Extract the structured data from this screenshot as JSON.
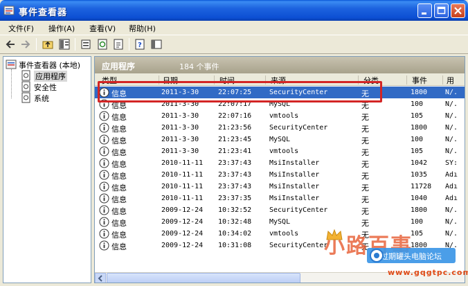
{
  "window": {
    "title": "事件查看器"
  },
  "menu": {
    "file": "文件(F)",
    "action": "操作(A)",
    "view": "查看(V)",
    "help": "帮助(H)"
  },
  "tree": {
    "root": "事件查看器 (本地)",
    "items": [
      "应用程序",
      "安全性",
      "系统"
    ]
  },
  "pane": {
    "title": "应用程序",
    "count": "184 个事件"
  },
  "columns": [
    "类型",
    "日期",
    "时间",
    "来源",
    "分类",
    "事件",
    "用"
  ],
  "rows": [
    {
      "type": "信息",
      "date": "2011-3-30",
      "time": "22:07:25",
      "source": "SecurityCenter",
      "category": "无",
      "event": "1800",
      "user": "N/."
    },
    {
      "type": "信息",
      "date": "2011-3-30",
      "time": "22:07:17",
      "source": "MySQL",
      "category": "无",
      "event": "100",
      "user": "N/."
    },
    {
      "type": "信息",
      "date": "2011-3-30",
      "time": "22:07:16",
      "source": "vmtools",
      "category": "无",
      "event": "105",
      "user": "N/."
    },
    {
      "type": "信息",
      "date": "2011-3-30",
      "time": "21:23:56",
      "source": "SecurityCenter",
      "category": "无",
      "event": "1800",
      "user": "N/."
    },
    {
      "type": "信息",
      "date": "2011-3-30",
      "time": "21:23:45",
      "source": "MySQL",
      "category": "无",
      "event": "100",
      "user": "N/."
    },
    {
      "type": "信息",
      "date": "2011-3-30",
      "time": "21:23:41",
      "source": "vmtools",
      "category": "无",
      "event": "105",
      "user": "N/."
    },
    {
      "type": "信息",
      "date": "2010-11-11",
      "time": "23:37:43",
      "source": "MsiInstaller",
      "category": "无",
      "event": "1042",
      "user": "SY:"
    },
    {
      "type": "信息",
      "date": "2010-11-11",
      "time": "23:37:43",
      "source": "MsiInstaller",
      "category": "无",
      "event": "1035",
      "user": "Adı"
    },
    {
      "type": "信息",
      "date": "2010-11-11",
      "time": "23:37:43",
      "source": "MsiInstaller",
      "category": "无",
      "event": "11728",
      "user": "Adı"
    },
    {
      "type": "信息",
      "date": "2010-11-11",
      "time": "23:37:35",
      "source": "MsiInstaller",
      "category": "无",
      "event": "1040",
      "user": "Adı"
    },
    {
      "type": "信息",
      "date": "2009-12-24",
      "time": "10:32:52",
      "source": "SecurityCenter",
      "category": "无",
      "event": "1800",
      "user": "N/."
    },
    {
      "type": "信息",
      "date": "2009-12-24",
      "time": "10:32:48",
      "source": "MySQL",
      "category": "无",
      "event": "100",
      "user": "N/."
    },
    {
      "type": "信息",
      "date": "2009-12-24",
      "time": "10:34:02",
      "source": "vmtools",
      "category": "无",
      "event": "105",
      "user": "N/."
    },
    {
      "type": "信息",
      "date": "2009-12-24",
      "time": "10:31:08",
      "source": "SecurityCenter",
      "category": "无",
      "event": "1800",
      "user": "N/."
    }
  ],
  "watermark": {
    "brand": "小路百事",
    "badge": "过期罐头电脑论坛",
    "url": "www.gqgtpc.com"
  },
  "colors": {
    "selection": "#316ac5",
    "highlight": "#d32525",
    "titlebar": "#0c4fd3"
  }
}
